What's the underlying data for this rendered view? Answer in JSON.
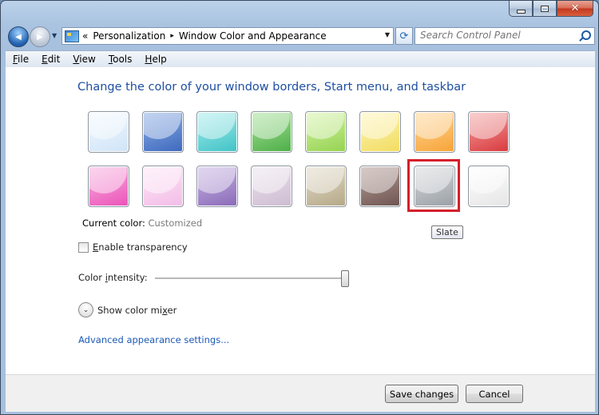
{
  "window": {
    "caption_buttons": {
      "minimize": "–",
      "maximize": "□",
      "close": "✕"
    }
  },
  "nav": {
    "back": "◀",
    "forward": "▶",
    "dropdown": "▼",
    "address_overflow": "«",
    "breadcrumbs": [
      "Personalization",
      "Window Color and Appearance"
    ],
    "breadcrumb_separator": "▸",
    "address_dropdown": "▼",
    "refresh_icon": "refresh-icon",
    "refresh_glyph": "⟳",
    "search_placeholder": "Search Control Panel"
  },
  "menu": {
    "items": [
      {
        "access": "F",
        "rest": "ile"
      },
      {
        "access": "E",
        "rest": "dit"
      },
      {
        "access": "V",
        "rest": "iew"
      },
      {
        "access": "T",
        "rest": "ools"
      },
      {
        "access": "H",
        "rest": "elp"
      }
    ]
  },
  "main": {
    "heading": "Change the color of your window borders, Start menu, and taskbar",
    "swatches": [
      {
        "id": "sky",
        "color_top": "#f4f9ff",
        "color_bottom": "#cfe4f7"
      },
      {
        "id": "twilight",
        "color_top": "#8fb0e6",
        "color_bottom": "#3c68bd"
      },
      {
        "id": "sea",
        "color_top": "#a9ecec",
        "color_bottom": "#3fc3c6"
      },
      {
        "id": "leaf",
        "color_top": "#a9e29a",
        "color_bottom": "#4cae46"
      },
      {
        "id": "lime",
        "color_top": "#d5f4a6",
        "color_bottom": "#94d24f"
      },
      {
        "id": "sun",
        "color_top": "#fff6b8",
        "color_bottom": "#f1dc60"
      },
      {
        "id": "pumpkin",
        "color_top": "#ffd89a",
        "color_bottom": "#f7a336"
      },
      {
        "id": "ruby",
        "color_top": "#f4a6a6",
        "color_bottom": "#d9383c"
      },
      {
        "id": "fuchsia",
        "color_top": "#f8b4df",
        "color_bottom": "#ec52b9"
      },
      {
        "id": "blush",
        "color_top": "#fde6f7",
        "color_bottom": "#f3bde7"
      },
      {
        "id": "violet",
        "color_top": "#c8b6e4",
        "color_bottom": "#8a6ab8"
      },
      {
        "id": "lavender",
        "color_top": "#ece3ee",
        "color_bottom": "#cdbcd2"
      },
      {
        "id": "taupe",
        "color_top": "#e3dccb",
        "color_bottom": "#b5a887"
      },
      {
        "id": "chocolate",
        "color_top": "#b59f9a",
        "color_bottom": "#6e5450"
      },
      {
        "id": "slate",
        "color_top": "#d7dadd",
        "color_bottom": "#9aa0a6"
      },
      {
        "id": "frost",
        "color_top": "#ffffff",
        "color_bottom": "#e5e5e5"
      }
    ],
    "selected_swatch": "slate",
    "tooltip": "Slate",
    "current_color_label": "Current color:",
    "current_color_value": "Customized",
    "transparency": {
      "access": "E",
      "rest": "nable transparency",
      "checked": false
    },
    "intensity": {
      "before": "Color ",
      "access": "i",
      "after": "ntensity:",
      "value_fraction": 1.0
    },
    "mixer": {
      "before": "Show color mi",
      "access": "x",
      "after": "er",
      "icon": "chevron-down-icon",
      "glyph": "⌄"
    },
    "advanced_link": "Advanced appearance settings..."
  },
  "footer": {
    "save_label": "Save changes",
    "cancel_label": "Cancel"
  },
  "colors": {
    "heading": "#1e4fa0",
    "link": "#1d5ab5",
    "selection_frame": "#d4202b"
  }
}
